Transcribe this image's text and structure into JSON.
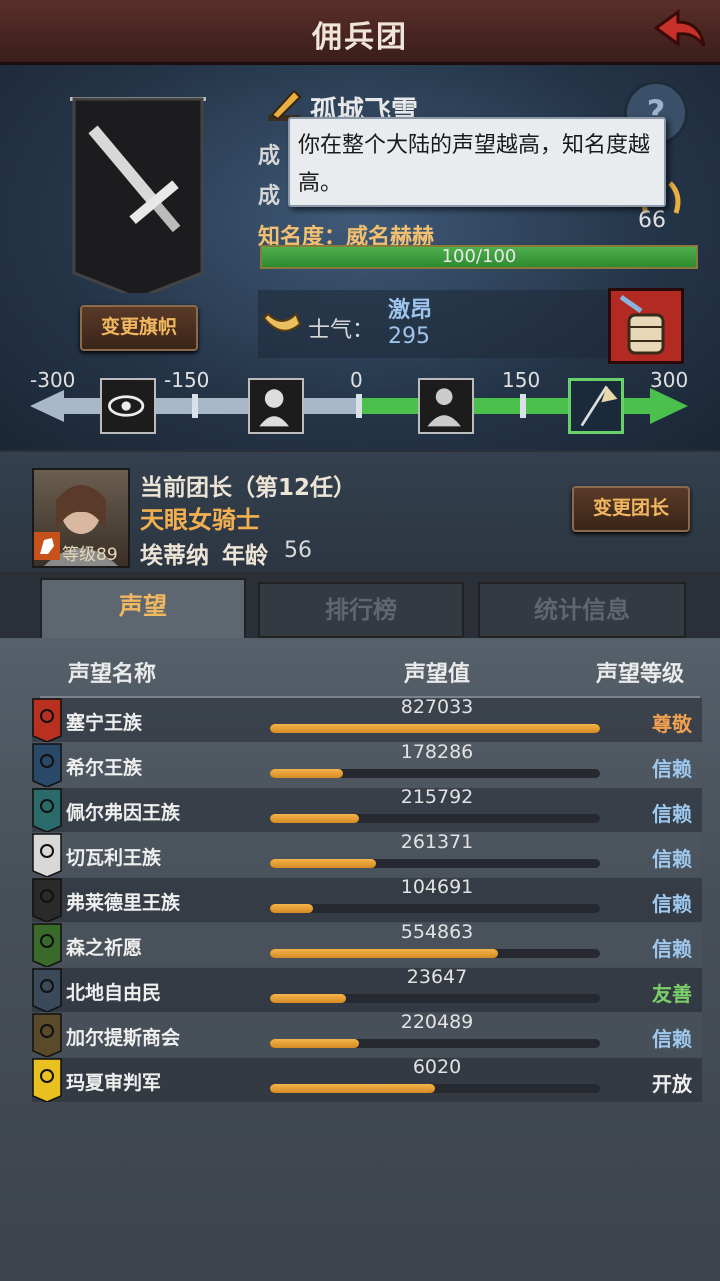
{
  "header": {
    "title": "佣兵团",
    "back_icon": "back-arrow-icon"
  },
  "guild": {
    "name": "孤城飞雪",
    "change_flag_label": "变更旗帜",
    "achievement_label_1": "成",
    "achievement_label_2": "成",
    "achievement_value": "66",
    "fame_label": "知名度：威名赫赫",
    "fame_progress": "100/100",
    "fame_fraction": 1.0
  },
  "tooltip": {
    "text": "你在整个大陆的声望越高，知名度越高。"
  },
  "morale": {
    "label": "士气：",
    "state": "激昂",
    "value": "295"
  },
  "scale": {
    "ticks": [
      "-300",
      "-150",
      "0",
      "150",
      "300"
    ]
  },
  "leader": {
    "heading": "当前团长（第12任）",
    "title": "天眼女骑士",
    "name": "埃蒂纳",
    "age_label": "年龄",
    "age": "56",
    "level": "等级89",
    "change_label": "变更团长"
  },
  "tabs": [
    {
      "label": "声望"
    },
    {
      "label": "排行榜"
    },
    {
      "label": "统计信息"
    }
  ],
  "columns": {
    "name": "声望名称",
    "value": "声望值",
    "level": "声望等级"
  },
  "colors": {
    "respect": "#f0a050",
    "trust": "#9ec8ee",
    "friendly": "#7ad06a",
    "open": "#eeeeee"
  },
  "factions": [
    {
      "name": "塞宁王族",
      "value": "827033",
      "fraction": 1.0,
      "level": "尊敬",
      "level_color": "#f0a050",
      "emblem_color": "#b83020"
    },
    {
      "name": "希尔王族",
      "value": "178286",
      "fraction": 0.22,
      "level": "信赖",
      "level_color": "#9ec8ee",
      "emblem_color": "#2a4868"
    },
    {
      "name": "佩尔弗因王族",
      "value": "215792",
      "fraction": 0.27,
      "level": "信赖",
      "level_color": "#9ec8ee",
      "emblem_color": "#2a6a6a"
    },
    {
      "name": "切瓦利王族",
      "value": "261371",
      "fraction": 0.32,
      "level": "信赖",
      "level_color": "#9ec8ee",
      "emblem_color": "#d8d8d8"
    },
    {
      "name": "弗莱德里王族",
      "value": "104691",
      "fraction": 0.13,
      "level": "信赖",
      "level_color": "#9ec8ee",
      "emblem_color": "#2a2a2a"
    },
    {
      "name": "森之祈愿",
      "value": "554863",
      "fraction": 0.69,
      "level": "信赖",
      "level_color": "#9ec8ee",
      "emblem_color": "#3a6a2a"
    },
    {
      "name": "北地自由民",
      "value": "23647",
      "fraction": 0.23,
      "level": "友善",
      "level_color": "#7ad06a",
      "emblem_color": "#3a4a5a"
    },
    {
      "name": "加尔提斯商会",
      "value": "220489",
      "fraction": 0.27,
      "level": "信赖",
      "level_color": "#9ec8ee",
      "emblem_color": "#5a4a2a"
    },
    {
      "name": "玛夏审判军",
      "value": "6020",
      "fraction": 0.5,
      "level": "开放",
      "level_color": "#eeeeee",
      "emblem_color": "#e8c020"
    }
  ]
}
